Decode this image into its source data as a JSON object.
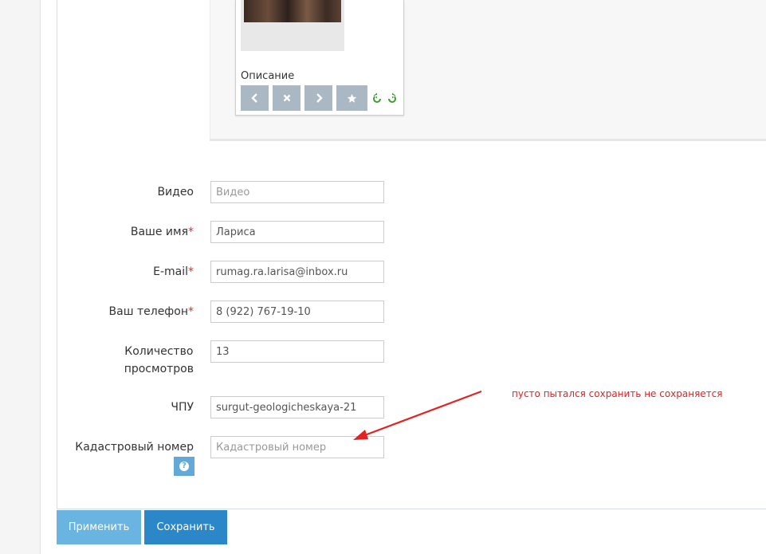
{
  "gallery": {
    "caption": "Описание",
    "tools": [
      {
        "icon": "chevron-left-icon"
      },
      {
        "icon": "close-icon"
      },
      {
        "icon": "chevron-right-icon"
      },
      {
        "icon": "star-icon"
      }
    ],
    "rotate_icons": [
      "rotate-left-icon",
      "rotate-right-icon"
    ]
  },
  "form": {
    "video": {
      "label": "Видео",
      "value": "",
      "placeholder": "Видео"
    },
    "name": {
      "label": "Ваше имя",
      "required_mark": "*",
      "value": "Лариса",
      "placeholder": ""
    },
    "email": {
      "label": "E-mail",
      "required_mark": "*",
      "value": "rumag.ra.larisa@inbox.ru",
      "placeholder": ""
    },
    "phone": {
      "label": "Ваш телефон",
      "required_mark": "*",
      "value": "8 (922) 767-19-10",
      "placeholder": ""
    },
    "views": {
      "label_line1": "Количество",
      "label_line2": "просмотров",
      "value": "13",
      "placeholder": ""
    },
    "slug": {
      "label": "ЧПУ",
      "value": "surgut-geologicheskaya-21",
      "placeholder": ""
    },
    "cadastral": {
      "label": "Кадастровый номер",
      "value": "",
      "placeholder": "Кадастровый номер",
      "help_glyph": "?"
    }
  },
  "annotation": {
    "text": "пусто пытался сохранить не сохраняется",
    "color": "#e02424"
  },
  "actions": {
    "apply_label": "Применить",
    "save_label": "Сохранить"
  },
  "colors": {
    "apply": "#6ab4e2",
    "save": "#2b87c8",
    "tool": "#a9b8c3",
    "required": "#d9302c"
  }
}
